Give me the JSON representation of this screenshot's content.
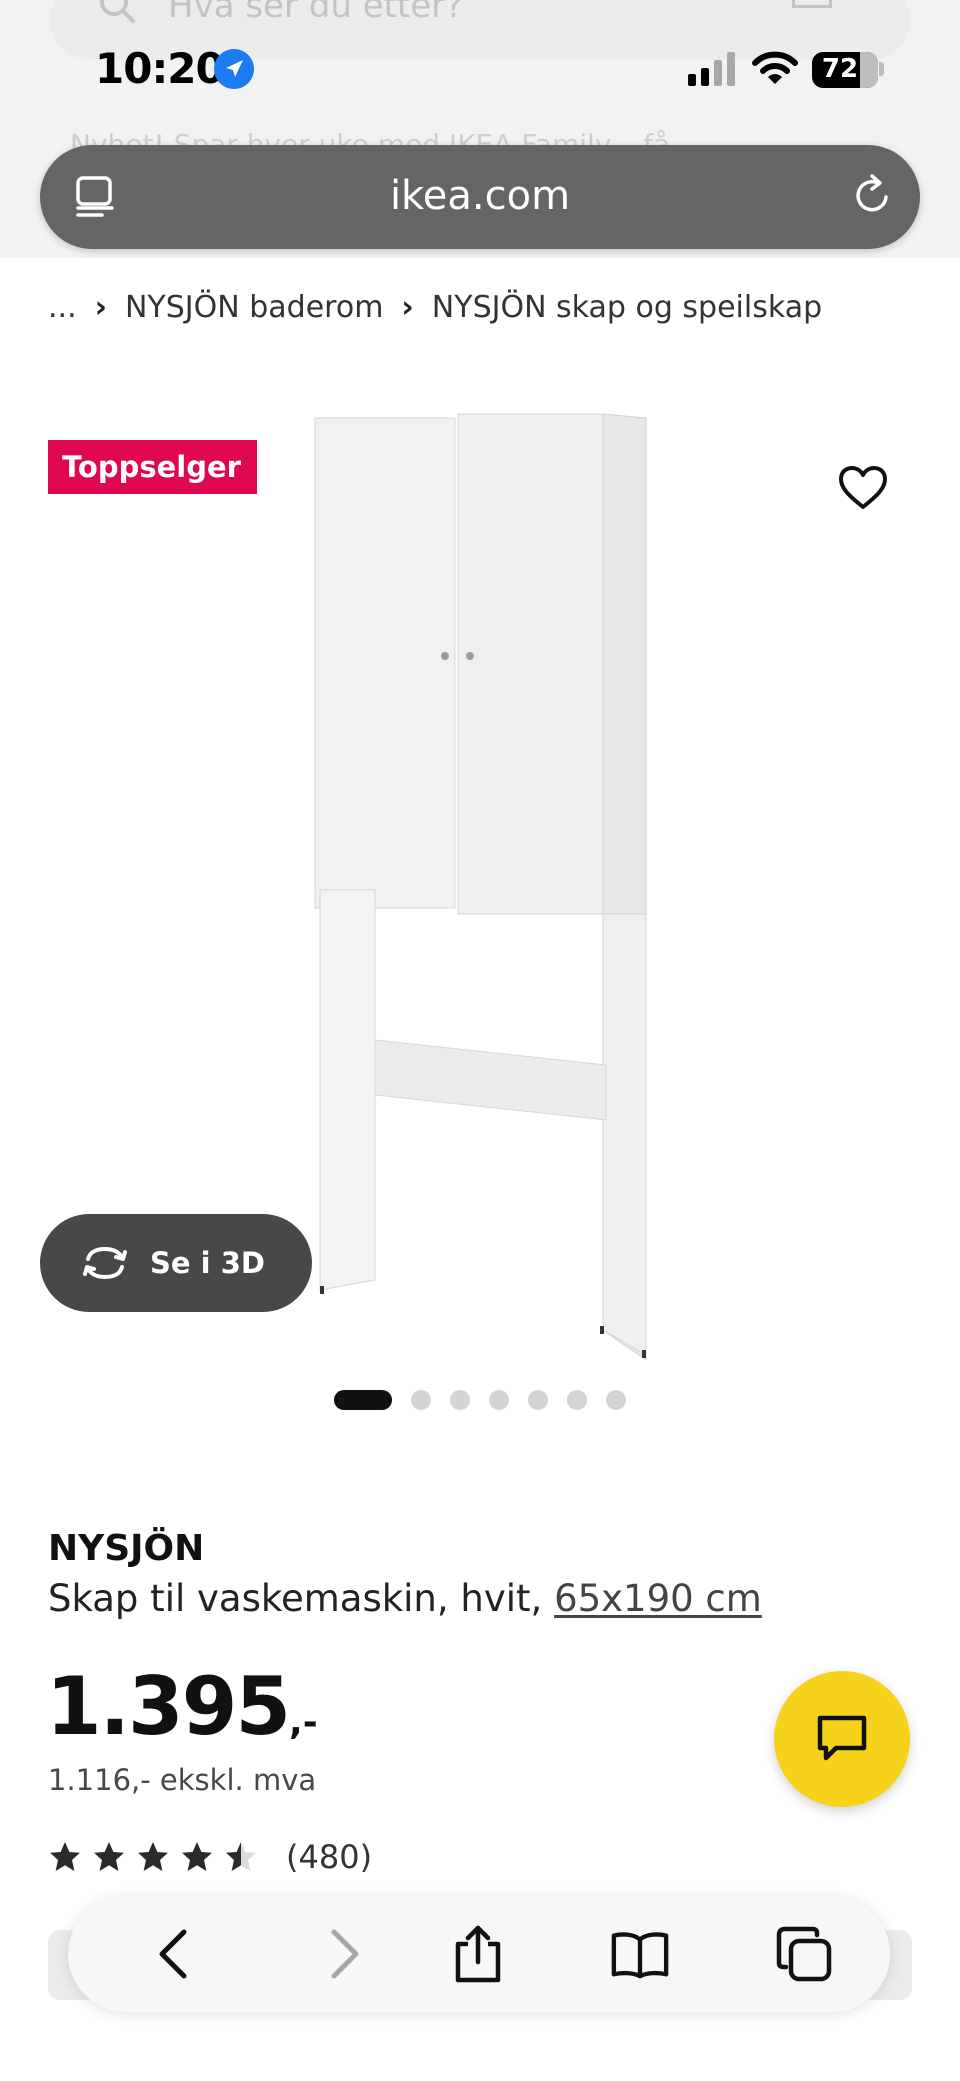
{
  "status_bar": {
    "time": "10:20",
    "battery": "72"
  },
  "background": {
    "search_placeholder": "Hva ser du etter?",
    "promo": "Nyhet! Spar hver uke med IKEA Family – få"
  },
  "browser": {
    "url": "ikea.com"
  },
  "breadcrumb": {
    "ellipsis": "...",
    "items": [
      "NYSJÖN baderom",
      "NYSJÖN skap og speilskap"
    ]
  },
  "product": {
    "badge": "Toppselger",
    "view_3d_label": "Se i 3D",
    "carousel": {
      "total": 7,
      "active": 1
    },
    "name": "NYSJÖN",
    "description": "Skap til vaskemaskin, hvit, ",
    "size_link": "65x190 cm",
    "price": "1.395",
    "price_suffix": ",-",
    "price_ex_vat": "1.116,- ekskl. mva",
    "rating": 4.5,
    "review_count": "(480)"
  },
  "colors": {
    "badge": "#e00751",
    "chat_fab": "#f6d21a",
    "url_bar": "#656565",
    "three_d_button": "#484848"
  },
  "toolbar_icons": [
    "back-icon",
    "forward-icon",
    "share-icon",
    "bookmarks-icon",
    "tabs-icon"
  ]
}
